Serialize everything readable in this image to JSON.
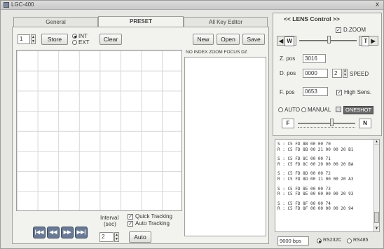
{
  "window": {
    "title": "LGC-400",
    "close_glyph": "x"
  },
  "tabs": [
    {
      "label": "General"
    },
    {
      "label": "PRESET"
    },
    {
      "label": "All Key Editor"
    }
  ],
  "preset": {
    "index_value": "1",
    "store_label": "Store",
    "int_label": "INT",
    "ext_label": "EXT",
    "clear_label": "Clear",
    "new_label": "New",
    "open_label": "Open",
    "save_label": "Save",
    "list_header": "NO INDEX ZOOM FOCUS DZ",
    "interval_label_1": "Interval",
    "interval_label_2": "(sec)",
    "interval_value": "2",
    "quick_tracking_label": "Quick Tracking",
    "auto_tracking_label": "Auto Tracking",
    "auto_label": "Auto",
    "nav_buttons": [
      "|◀◀",
      "◀◀",
      "▶▶",
      "▶▶|"
    ]
  },
  "lens": {
    "header": "<< LENS  Control >>",
    "dzoom_label": "D.ZOOM",
    "w_label": "W",
    "t_label": "T",
    "zpos_label": "Z. pos",
    "zpos_value": "3016",
    "dpos_label": "D. pos",
    "dpos_value": "0000",
    "speed_value": "2",
    "speed_label": "SPEED",
    "fpos_label": "F. pos",
    "fpos_value": "0653",
    "high_sens_label": "High Sens.",
    "auto_label": "AUTO",
    "manual_label": "MANUAL",
    "oneshot_label": "ONESHOT",
    "f_label": "F",
    "n_label": "N"
  },
  "log": [
    {
      "s": "S : C5 FD 8B 00 00 70",
      "r": "R : C5 FD 8B 00 21 00 00 20 B1"
    },
    {
      "s": "S : C5 FD 8C 00 00 71",
      "r": "R : C5 FD 8C 00 29 00 00 20 BA"
    },
    {
      "s": "S : C5 FD 8D 00 00 72",
      "r": "R : C5 FD 8D 00 11 00 00 20 A3"
    },
    {
      "s": "S : C5 FD 8E 00 00 73",
      "r": "R : C5 FD 8E 00 00 00 00 20 93"
    },
    {
      "s": "S : C5 FD 8F 00 00 74",
      "r": "R : C5 FD 8F 00 00 00 00 20 94"
    }
  ],
  "status": {
    "baud": "9600 bps",
    "rs232_label": "RS232C",
    "rs485_label": "RS485"
  }
}
